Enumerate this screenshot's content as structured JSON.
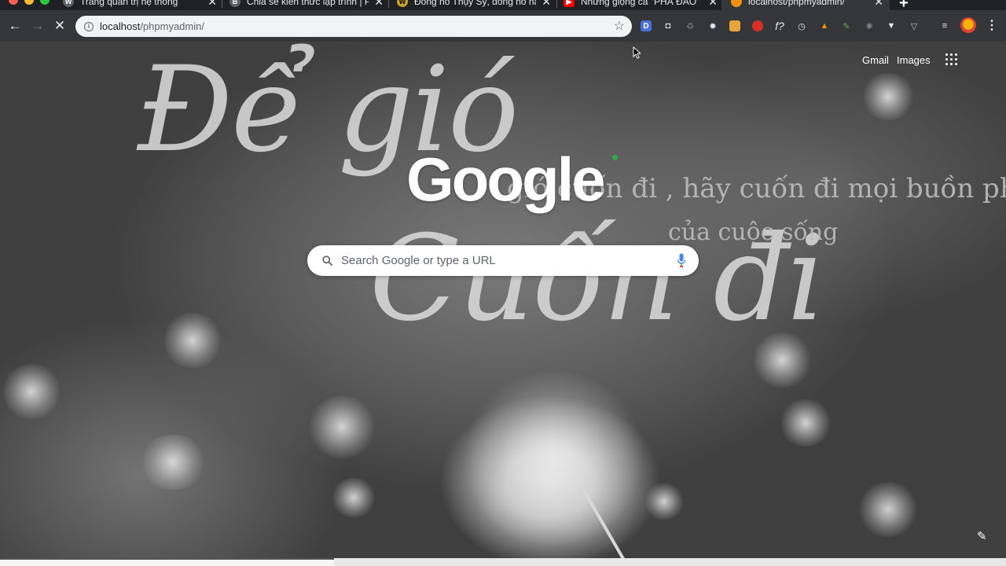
{
  "tabs": [
    {
      "title": "Trang quản trị hệ thống",
      "favicon": "wordpress-icon",
      "active": false
    },
    {
      "title": "Chia sẻ kiến thức lập trình | PH",
      "favicon": "blog-icon",
      "active": false
    },
    {
      "title": "Đồng hồ Thụy Sỹ, đồng hồ nam",
      "favicon": "watch-shop-icon",
      "active": false
    },
    {
      "title": "Những giọng ca \"PHÁ ĐẢO\" cả",
      "favicon": "youtube-icon",
      "active": false
    },
    {
      "title": "localhost/phpmyadmin/",
      "favicon": "phpmyadmin-icon",
      "active": true
    }
  ],
  "close_glyph": "✕",
  "new_tab_glyph": "+",
  "omnibox": {
    "host": "localhost",
    "path": "/phpmyadmin/"
  },
  "header_links": {
    "gmail": "Gmail",
    "images": "Images"
  },
  "logo_text": "Google",
  "search": {
    "placeholder": "Search Google or type a URL"
  },
  "background_text": {
    "script_line1": "Để gió",
    "script_line2": "Cuốn đi",
    "hand_line1": "gió cuốn đi , hãy cuốn đi mọi buồn phiền....",
    "hand_line2": "của cuộc sống"
  },
  "colors": {
    "tabstrip": "#202124",
    "toolbar": "#35363a",
    "omnibox": "#f1f3f4",
    "mic_blue": "#4285f4",
    "mic_red": "#ea4335",
    "logo_dot_green": "#34a853"
  }
}
